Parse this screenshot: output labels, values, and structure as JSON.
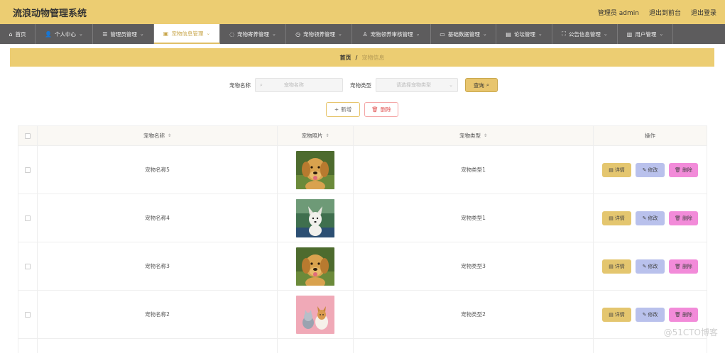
{
  "header": {
    "title": "流浪动物管理系统",
    "admin_label": "管理员 admin",
    "front_label": "退出到前台",
    "logout_label": "退出登录"
  },
  "nav": [
    {
      "label": "首页",
      "icon": "home-icon",
      "glyph": "⌂",
      "width": 50,
      "chevron": ""
    },
    {
      "label": "个人中心",
      "icon": "user-icon",
      "glyph": "👤",
      "width": 81,
      "chevron": "⌄"
    },
    {
      "label": "管理员管理",
      "icon": "sliders-icon",
      "glyph": "☰",
      "width": 86,
      "chevron": "⌄"
    },
    {
      "label": "宠物信息管理",
      "icon": "box-icon",
      "glyph": "▣",
      "width": 93,
      "chevron": "⌄"
    },
    {
      "label": "宠物寄养管理",
      "icon": "circle-icon",
      "glyph": "◌",
      "width": 93,
      "chevron": "⌄"
    },
    {
      "label": "宠物领养管理",
      "icon": "clock-icon",
      "glyph": "◷",
      "width": 93,
      "chevron": "⌄"
    },
    {
      "label": "宠物领养审核管理",
      "icon": "badge-icon",
      "glyph": "♙",
      "width": 111,
      "chevron": "⌄"
    },
    {
      "label": "基础数据管理",
      "icon": "chat-icon",
      "glyph": "▭",
      "width": 92,
      "chevron": "⌄"
    },
    {
      "label": "论坛管理",
      "icon": "shop-icon",
      "glyph": "▤",
      "width": 79,
      "chevron": "⌄"
    },
    {
      "label": "公告信息管理",
      "icon": "expand-icon",
      "glyph": "⛶",
      "width": 92,
      "chevron": "⌄"
    },
    {
      "label": "用户管理",
      "icon": "notebook-icon",
      "glyph": "▥",
      "width": 78,
      "chevron": "⌄"
    }
  ],
  "nav_active_index": 3,
  "breadcrumb": {
    "home": "首页",
    "sep": "/",
    "current": "宠物信息"
  },
  "search": {
    "name_label": "宠物名称",
    "name_placeholder": "宠物名称",
    "type_label": "宠物类型",
    "type_placeholder": "请选择宠物类型",
    "query_label": "查询"
  },
  "actions": {
    "add_label": "新增",
    "delete_label": "删除"
  },
  "table": {
    "headers": {
      "name": "宠物名称",
      "image": "宠物照片",
      "type": "宠物类型",
      "ops": "操作"
    },
    "rows": [
      {
        "name": "宠物名称5",
        "type": "宠物类型1",
        "image": "golden-dog"
      },
      {
        "name": "宠物名称4",
        "type": "宠物类型1",
        "image": "white-dog"
      },
      {
        "name": "宠物名称3",
        "type": "宠物类型3",
        "image": "golden-dog"
      },
      {
        "name": "宠物名称2",
        "type": "宠物类型2",
        "image": "cat-dog-pink"
      }
    ],
    "op_labels": {
      "detail": "详情",
      "edit": "修改",
      "delete": "删除"
    }
  },
  "watermark": "@51CTO博客"
}
